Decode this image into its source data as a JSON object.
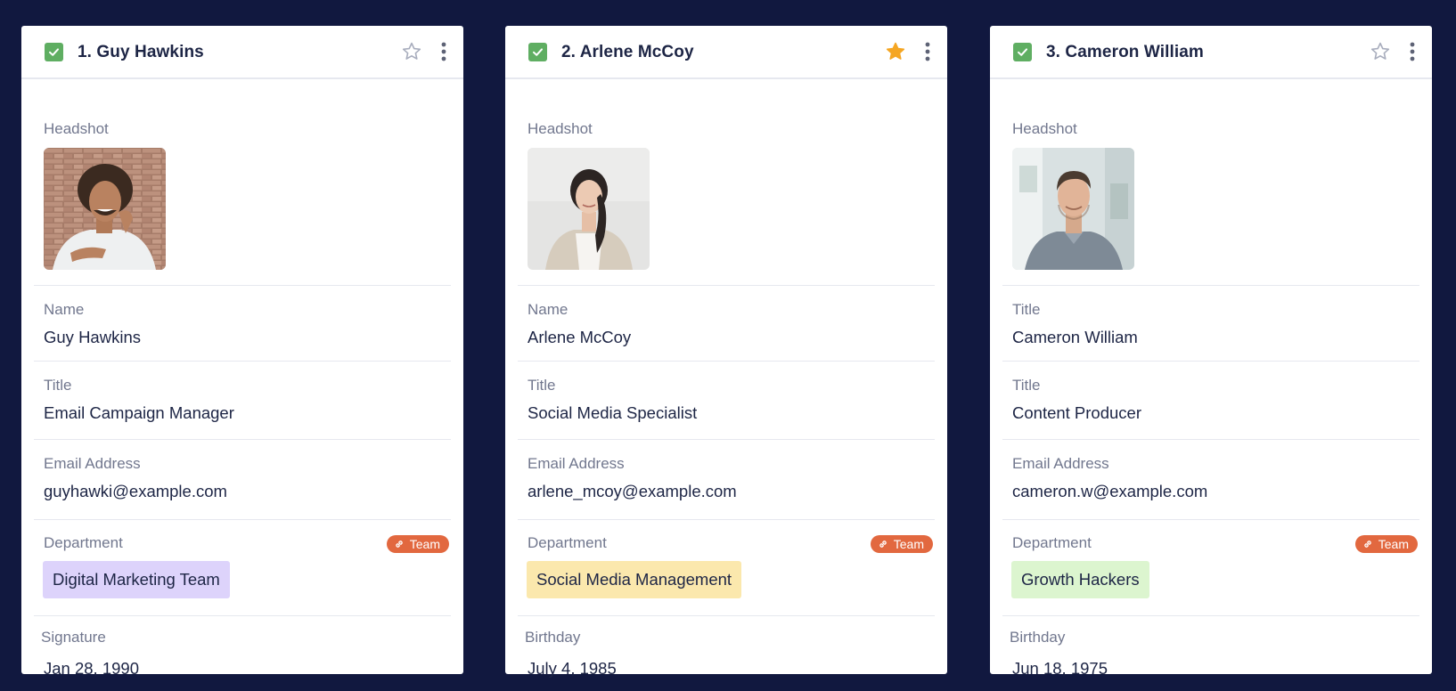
{
  "cards": [
    {
      "title": "1. Guy Hawkins",
      "starred": false,
      "headshot_label": "Headshot",
      "fields": [
        {
          "label": "Name",
          "value": "Guy Hawkins"
        },
        {
          "label": "Title",
          "value": "Email Campaign Manager"
        },
        {
          "label": "Email Address",
          "value": "guyhawki@example.com"
        }
      ],
      "department": {
        "label": "Department",
        "badge": "Team",
        "value": "Digital Marketing Team",
        "tag_color": "#ddd3fb"
      },
      "last_field": {
        "label": "Signature",
        "value": "Jan 28, 1990"
      }
    },
    {
      "title": "2. Arlene McCoy",
      "starred": true,
      "headshot_label": "Headshot",
      "fields": [
        {
          "label": "Name",
          "value": "Arlene McCoy"
        },
        {
          "label": "Title",
          "value": "Social Media Specialist"
        },
        {
          "label": "Email Address",
          "value": "arlene_mcoy@example.com"
        }
      ],
      "department": {
        "label": "Department",
        "badge": "Team",
        "value": "Social Media Management",
        "tag_color": "#fbe8ad"
      },
      "last_field": {
        "label": "Birthday",
        "value": "July 4, 1985"
      }
    },
    {
      "title": "3. Cameron William",
      "starred": false,
      "headshot_label": "Headshot",
      "fields": [
        {
          "label": "Title",
          "value": "Cameron William"
        },
        {
          "label": "Title",
          "value": "Content Producer"
        },
        {
          "label": "Email Address",
          "value": "cameron.w@example.com"
        }
      ],
      "department": {
        "label": "Department",
        "badge": "Team",
        "value": "Growth Hackers",
        "tag_color": "#dcf5cf"
      },
      "last_field": {
        "label": "Birthday",
        "value": "Jun 18, 1975"
      }
    }
  ],
  "colors": {
    "background": "#11183f",
    "checkbox": "#5fae62",
    "star_active": "#f5a623",
    "badge": "#e2683f"
  },
  "icons": [
    "check-icon",
    "star-icon",
    "more-vertical-icon",
    "link-icon"
  ]
}
